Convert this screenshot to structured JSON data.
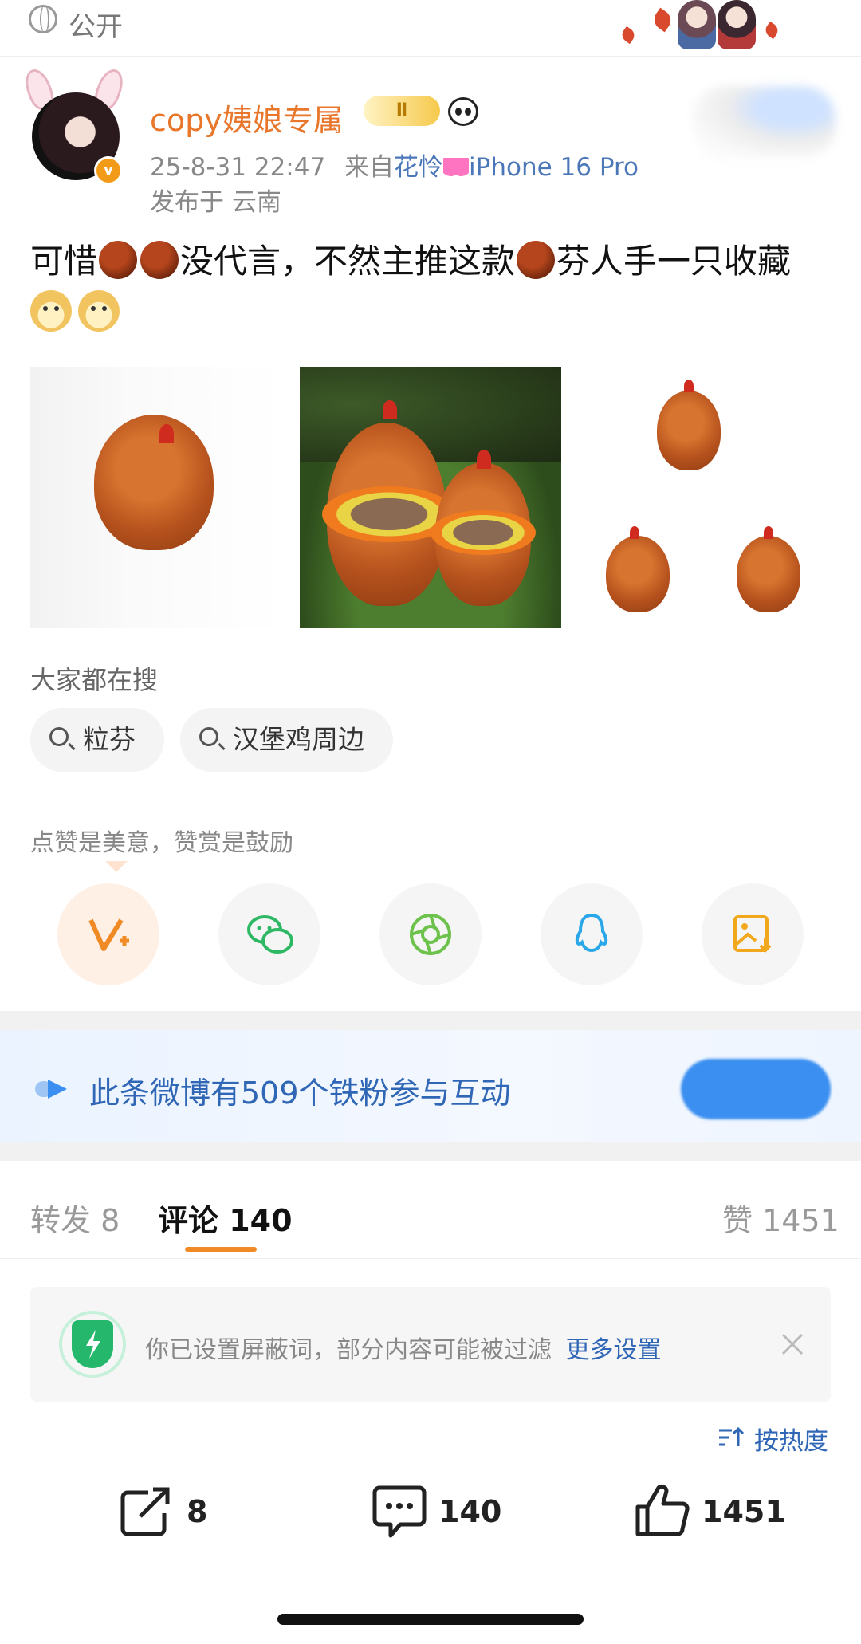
{
  "visibility": {
    "label": "公开",
    "icon": "globe-icon"
  },
  "post": {
    "username": "copy姨娘专属",
    "level_badge": "Ⅱ",
    "datetime": "25-8-31 22:47",
    "source_prefix": "来自",
    "source_name": "花怜",
    "device": "iPhone 16 Pro",
    "location": "发布于 云南",
    "text_part1": "可惜",
    "text_part2": "没代言，不然主推这款",
    "text_part3": "芬人手一只收藏"
  },
  "search": {
    "section_label": "大家都在搜",
    "chips": [
      {
        "label": "粒芬"
      },
      {
        "label": "汉堡鸡周边"
      }
    ]
  },
  "reward": {
    "tip": "点赞是美意，赞赏是鼓励",
    "share_icons": [
      "reward-icon",
      "wechat-icon",
      "moments-icon",
      "qq-icon",
      "save-image-icon"
    ]
  },
  "fans_banner": {
    "text": "此条微博有509个铁粉参与互动"
  },
  "tabs": {
    "repost_label": "转发 8",
    "comment_label": "评论 140",
    "like_label": "赞 1451"
  },
  "notice": {
    "text": "你已设置屏蔽词，部分内容可能被过滤",
    "link": "更多设置"
  },
  "sort": {
    "label": "按热度"
  },
  "bottom_bar": {
    "repost_count": "8",
    "comment_count": "140",
    "like_count": "1451"
  },
  "colors": {
    "username": "#e8762b",
    "link_blue": "#2f66b5",
    "accent_orange": "#f08a24",
    "banner_button": "#3b8ff0"
  }
}
